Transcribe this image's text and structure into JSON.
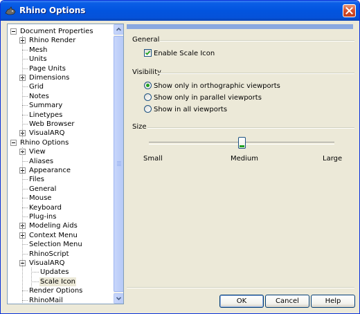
{
  "window": {
    "title": "Rhino Options",
    "close_icon": "close-icon"
  },
  "tree": {
    "items": [
      {
        "label": "Document Properties",
        "depth": 0,
        "expander": "minus"
      },
      {
        "label": "Rhino Render",
        "depth": 1,
        "expander": "plus"
      },
      {
        "label": "Mesh",
        "depth": 1,
        "expander": "none"
      },
      {
        "label": "Units",
        "depth": 1,
        "expander": "none"
      },
      {
        "label": "Page Units",
        "depth": 1,
        "expander": "none"
      },
      {
        "label": "Dimensions",
        "depth": 1,
        "expander": "plus"
      },
      {
        "label": "Grid",
        "depth": 1,
        "expander": "none"
      },
      {
        "label": "Notes",
        "depth": 1,
        "expander": "none"
      },
      {
        "label": "Summary",
        "depth": 1,
        "expander": "none"
      },
      {
        "label": "Linetypes",
        "depth": 1,
        "expander": "none"
      },
      {
        "label": "Web Browser",
        "depth": 1,
        "expander": "none"
      },
      {
        "label": "VisualARQ",
        "depth": 1,
        "expander": "plus"
      },
      {
        "label": "Rhino Options",
        "depth": 0,
        "expander": "minus"
      },
      {
        "label": "View",
        "depth": 1,
        "expander": "plus"
      },
      {
        "label": "Aliases",
        "depth": 1,
        "expander": "none"
      },
      {
        "label": "Appearance",
        "depth": 1,
        "expander": "plus"
      },
      {
        "label": "Files",
        "depth": 1,
        "expander": "none"
      },
      {
        "label": "General",
        "depth": 1,
        "expander": "none"
      },
      {
        "label": "Mouse",
        "depth": 1,
        "expander": "none"
      },
      {
        "label": "Keyboard",
        "depth": 1,
        "expander": "none"
      },
      {
        "label": "Plug-ins",
        "depth": 1,
        "expander": "none"
      },
      {
        "label": "Modeling Aids",
        "depth": 1,
        "expander": "plus"
      },
      {
        "label": "Context Menu",
        "depth": 1,
        "expander": "plus"
      },
      {
        "label": "Selection Menu",
        "depth": 1,
        "expander": "none"
      },
      {
        "label": "RhinoScript",
        "depth": 1,
        "expander": "none"
      },
      {
        "label": "VisualARQ",
        "depth": 1,
        "expander": "minus"
      },
      {
        "label": "Updates",
        "depth": 2,
        "expander": "none"
      },
      {
        "label": "Scale Icon",
        "depth": 2,
        "expander": "none",
        "selected": true
      },
      {
        "label": "Render Options",
        "depth": 1,
        "expander": "none"
      },
      {
        "label": "RhinoMail",
        "depth": 1,
        "expander": "none"
      },
      {
        "label": "...",
        "depth": 1,
        "expander": "none"
      }
    ]
  },
  "scrollbar": {
    "up_icon": "chevron-up-icon",
    "down_icon": "chevron-down-icon"
  },
  "general": {
    "title": "General",
    "enable_scale_icon": {
      "label": "Enable Scale Icon",
      "checked": true
    }
  },
  "visibility": {
    "title": "Visibility",
    "options": [
      {
        "label": "Show only in orthographic viewports",
        "selected": true
      },
      {
        "label": "Show only in parallel viewports",
        "selected": false
      },
      {
        "label": "Show in all viewports",
        "selected": false
      }
    ]
  },
  "size": {
    "title": "Size",
    "labels": {
      "small": "Small",
      "medium": "Medium",
      "large": "Large"
    },
    "value": "Medium",
    "level": 0.5
  },
  "buttons": {
    "ok": "OK",
    "cancel": "Cancel",
    "help": "Help"
  },
  "colors": {
    "title_bar": "#0254df",
    "accent_bar": "#8aa8e0",
    "radio_dot": "#21a121",
    "face": "#ece9d8"
  }
}
